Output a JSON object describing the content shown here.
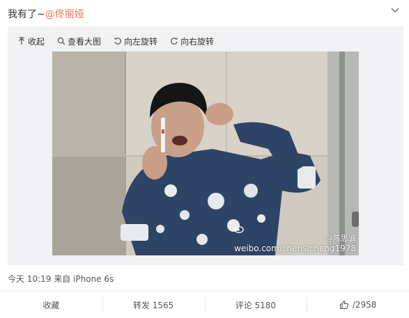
{
  "post": {
    "text": "我有了~",
    "mention": "@佟丽娅"
  },
  "toolbar": {
    "collapse_label": "收起",
    "view_large_label": "查看大图",
    "rotate_left_label": "向左旋转",
    "rotate_right_label": "向右旋转"
  },
  "photo": {
    "watermark_handle": "@陈思诚",
    "watermark_url": "weibo.com/chensicheng1978"
  },
  "meta": {
    "timestamp": "今天 10:19 来自 iPhone 6s"
  },
  "actions": {
    "favorite_label": "收藏",
    "repost_label": "转发 1565",
    "comment_label": "评论 5180",
    "like_label": "/2958"
  },
  "colors": {
    "mention": "#eb7350",
    "media_background": "#f2f2f5"
  },
  "icons": {
    "collapse": "arrow-up-icon",
    "view_large": "magnifier-icon",
    "rotate_left": "rotate-left-icon",
    "rotate_right": "rotate-right-icon",
    "like": "thumbs-up-icon",
    "more": "chevron-down-icon",
    "watermark": "weibo-eye-icon"
  }
}
